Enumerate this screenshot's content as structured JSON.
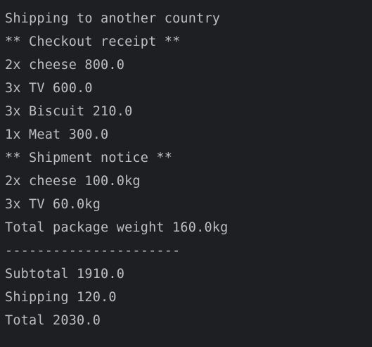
{
  "console": {
    "lines": [
      "Shipping to another country",
      "** Checkout receipt **",
      "2x cheese 800.0",
      "3x TV 600.0",
      "3x Biscuit 210.0",
      "1x Meat 300.0",
      "** Shipment notice **",
      "2x cheese 100.0kg",
      "3x TV 60.0kg",
      "Total package weight 160.0kg",
      "----------------------",
      "Subtotal 1910.0",
      "Shipping 120.0",
      "Total 2030.0"
    ],
    "colors": {
      "background": "#1e1f22",
      "text": "#bcbec4"
    }
  }
}
